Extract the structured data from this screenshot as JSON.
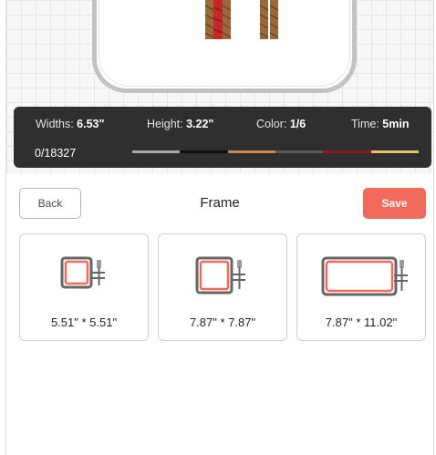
{
  "stats": {
    "width_label": "Widths:",
    "width_value": "6.53\"",
    "height_label": "Height:",
    "height_value": "3.22\"",
    "color_label": "Color:",
    "color_value": "1/6",
    "time_label": "Time:",
    "time_value": "5min",
    "progress": "0/18327",
    "thread_colors": [
      "#a9a9a9",
      "#111111",
      "#c98a52",
      "#5a5a5a",
      "#8b1a1a",
      "#e6c06a"
    ]
  },
  "header": {
    "back_label": "Back",
    "title": "Frame",
    "save_label": "Save"
  },
  "frames": [
    {
      "label": "5.51\" * 5.51\""
    },
    {
      "label": "7.87\" * 7.87\""
    },
    {
      "label": "7.87\" * 11.02\""
    }
  ],
  "colors": {
    "save": "#f26a5c",
    "hoop_red": "#f26a5c",
    "hoop_gray": "#666666",
    "stats_bg": "#2f2f2f"
  }
}
